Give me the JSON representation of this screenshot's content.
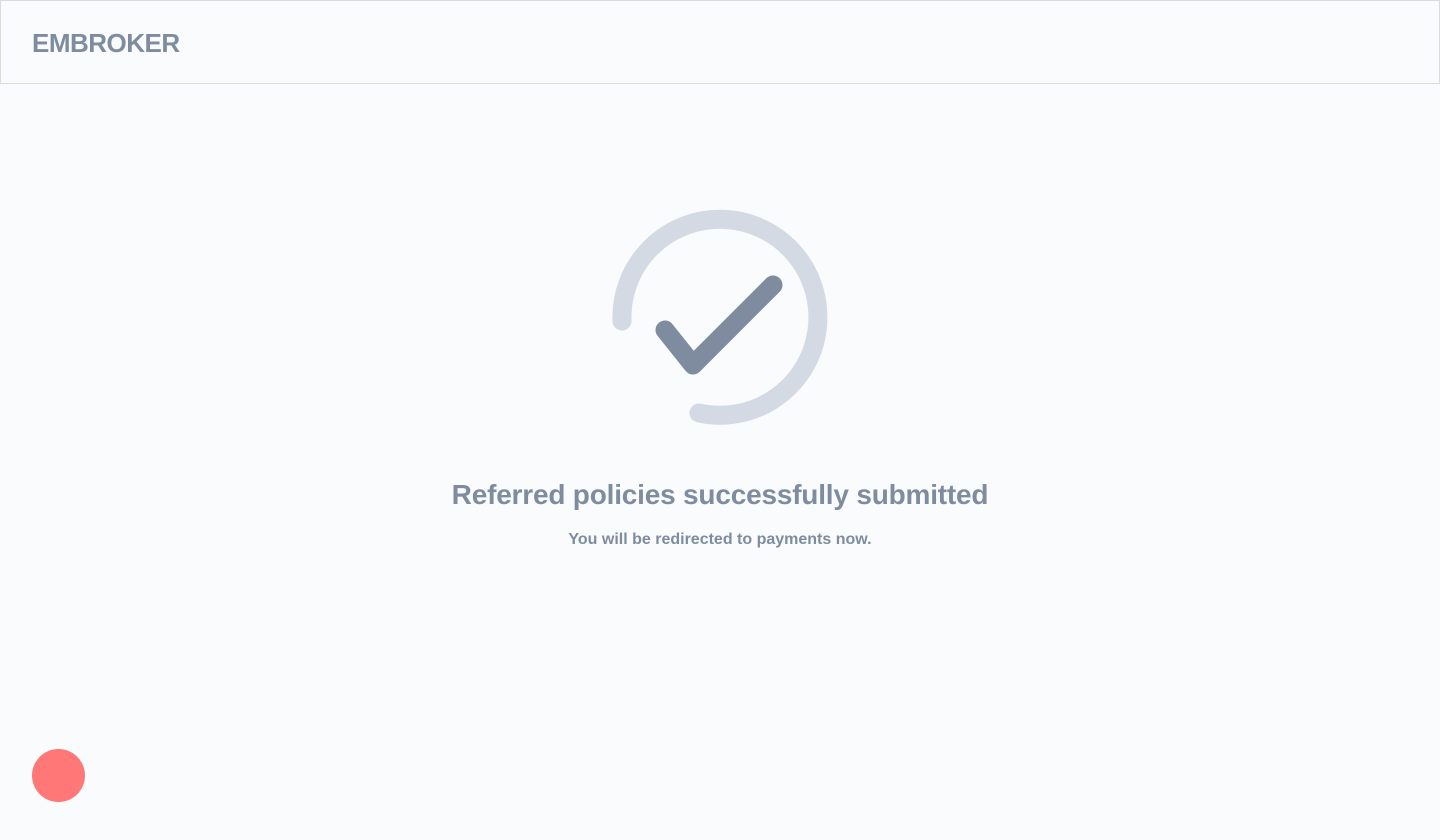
{
  "header": {
    "logo_text": "EMBROKER"
  },
  "status": {
    "icon": "check-circle-icon",
    "title": "Referred policies successfully submitted",
    "subtitle": "You will be redirected to payments now."
  },
  "floating_action": {
    "icon": "red-circle-button"
  },
  "colors": {
    "background": "#f9fbfd",
    "text": "#7f8ca0",
    "ring": "#d3dae3",
    "check": "#7f8ca0",
    "header_border": "#d7dce3",
    "fab": "#ff7777"
  }
}
